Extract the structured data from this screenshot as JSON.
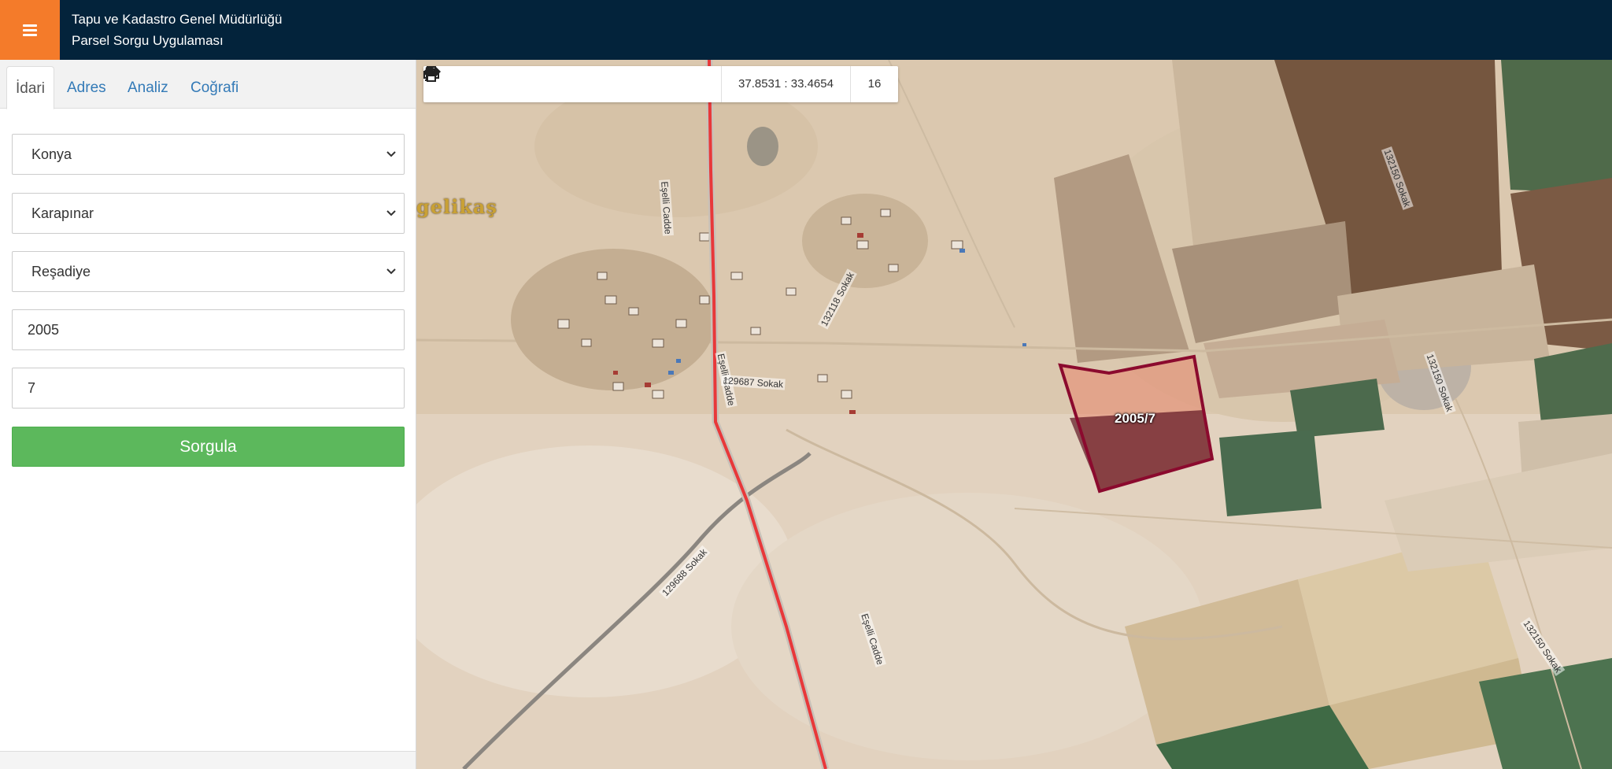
{
  "header": {
    "menu_icon": "hamburger-icon",
    "title_line1": "Tapu ve Kadastro Genel Müdürlüğü",
    "title_line2": "Parsel Sorgu Uygulaması",
    "bg_color": "#03233b",
    "accent_color": "#f47b2a"
  },
  "sidebar": {
    "tabs": [
      {
        "label": "İdari",
        "active": true
      },
      {
        "label": "Adres",
        "active": false
      },
      {
        "label": "Analiz",
        "active": false
      },
      {
        "label": "Coğrafi",
        "active": false
      }
    ],
    "province_select": {
      "value": "Konya"
    },
    "district_select": {
      "value": "Karapınar"
    },
    "neighborhood_select": {
      "value": "Reşadiye"
    },
    "block_input": {
      "value": "2005"
    },
    "parcel_input": {
      "value": "7"
    },
    "submit_label": "Sorgula",
    "submit_color": "#5cb85c"
  },
  "toolbar": {
    "buttons": [
      {
        "name": "zoom-in",
        "icon": "plus-icon"
      },
      {
        "name": "zoom-out",
        "icon": "minus-icon"
      },
      {
        "name": "refresh",
        "icon": "refresh-icon"
      },
      {
        "name": "locate",
        "icon": "crosshair-icon"
      },
      {
        "name": "info",
        "icon": "info-icon"
      },
      {
        "name": "favorite",
        "icon": "star-icon"
      },
      {
        "name": "measure",
        "icon": "horizontal-arrows-icon"
      },
      {
        "name": "print",
        "icon": "printer-icon"
      }
    ],
    "coordinates": "37.8531 : 33.4654",
    "zoom_level": "16"
  },
  "map": {
    "place_label": "gelikaş",
    "parcel_label": "2005/7",
    "parcel_stroke": "#8b0a2e",
    "road_color": "#e8383a",
    "street_labels": [
      "Eşelli Cadde",
      "Eşelli Cadde",
      "Eşelli Cadde",
      "132118 Sokak",
      "129687 Sokak",
      "129688 Sokak",
      "132150 Sokak",
      "132150 Sokak",
      "132150 Sokak"
    ]
  }
}
